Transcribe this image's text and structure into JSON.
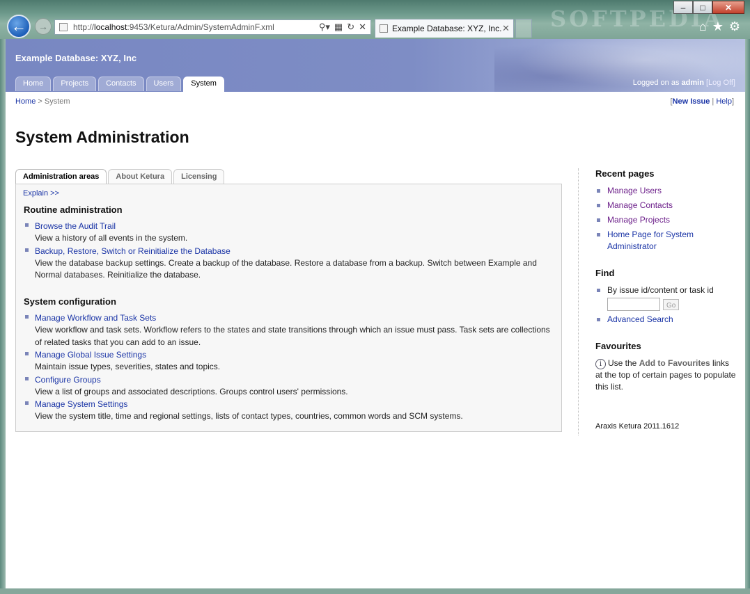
{
  "browser": {
    "url_prefix": "http://",
    "url_host": "localhost",
    "url_rest": ":9453/Ketura/Admin/SystemAdminF.xml",
    "tab_title": "Example Database: XYZ, Inc...",
    "watermark": "SOFTPEDIA"
  },
  "header": {
    "app_title": "Example Database: XYZ, Inc",
    "nav": [
      "Home",
      "Projects",
      "Contacts",
      "Users",
      "System"
    ],
    "logged_prefix": "Logged on as ",
    "logged_user": "admin",
    "logoff": "[Log Off]"
  },
  "breadcrumb": {
    "home": "Home",
    "sep": " > ",
    "current": "System"
  },
  "toplinks": {
    "new_issue": "New Issue",
    "help": "Help"
  },
  "page_title": "System Administration",
  "subtabs": [
    "Administration areas",
    "About Ketura",
    "Licensing"
  ],
  "panel": {
    "explain": "Explain >>",
    "routine_heading": "Routine administration",
    "routine": [
      {
        "link": "Browse the Audit Trail",
        "desc": "View a history of all events in the system."
      },
      {
        "link": "Backup, Restore, Switch or Reinitialize the Database",
        "desc": "View the database backup settings. Create a backup of the database. Restore a database from a backup. Switch between Example and Normal databases. Reinitialize the database."
      }
    ],
    "config_heading": "System configuration",
    "config": [
      {
        "link": "Manage Workflow and Task Sets",
        "desc": "View workflow and task sets. Workflow refers to the states and state transitions through which an issue must pass. Task sets are collections of related tasks that you can add to an issue."
      },
      {
        "link": "Manage Global Issue Settings",
        "desc": "Maintain issue types, severities, states and topics."
      },
      {
        "link": "Configure Groups",
        "desc": "View a list of groups and associated descriptions. Groups control users' permissions."
      },
      {
        "link": "Manage System Settings",
        "desc": "View the system title, time and regional settings, lists of contact types, countries, common words and SCM systems."
      }
    ]
  },
  "sidebar": {
    "recent_heading": "Recent pages",
    "recent": [
      "Manage Users",
      "Manage Contacts",
      "Manage Projects",
      "Home Page for System Administrator"
    ],
    "find_heading": "Find",
    "find_label": "By issue id/content or task id",
    "go": "Go",
    "advanced_search": "Advanced Search",
    "fav_heading": "Favourites",
    "fav_pre": "Use the ",
    "fav_bold": "Add to Favourites",
    "fav_post": " links at the top of certain pages to populate this list.",
    "version": "Araxis Ketura 2011.1612"
  }
}
